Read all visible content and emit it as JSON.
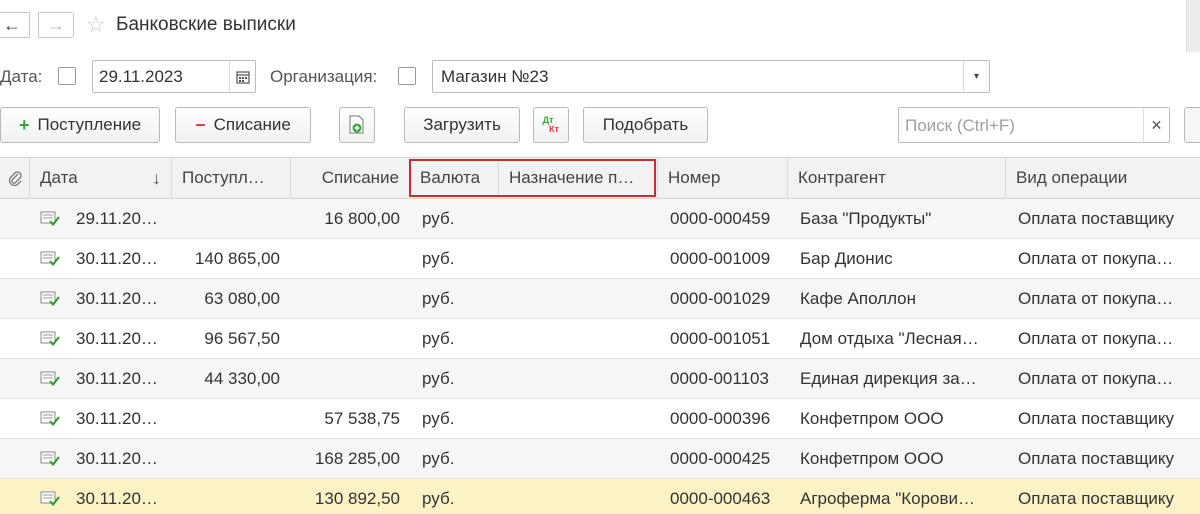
{
  "window": {
    "title": "Банковские выписки"
  },
  "filters": {
    "date_label": "Дата:",
    "date_value": "29.11.2023",
    "org_label": "Организация:",
    "org_value": "Магазин №23"
  },
  "toolbar": {
    "incoming_label": "Поступление",
    "outgoing_label": "Списание",
    "load_label": "Загрузить",
    "dtkt_top": "Дт",
    "dtkt_bottom": "Кт",
    "select_label": "Подобрать",
    "search_placeholder": "Поиск (Ctrl+F)"
  },
  "table": {
    "columns": {
      "date": "Дата",
      "incoming": "Поступл…",
      "outgoing": "Списание",
      "currency": "Валюта",
      "purpose": "Назначение п…",
      "number": "Номер",
      "counterparty": "Контрагент",
      "operation": "Вид операции"
    },
    "rows": [
      {
        "date": "29.11.20…",
        "incoming": "",
        "outgoing": "16 800,00",
        "currency": "руб.",
        "purpose": "",
        "number": "0000-000459",
        "counterparty": "База \"Продукты\"",
        "operation": "Оплата поставщику"
      },
      {
        "date": "30.11.20…",
        "incoming": "140 865,00",
        "outgoing": "",
        "currency": "руб.",
        "purpose": "",
        "number": "0000-001009",
        "counterparty": "Бар Дионис",
        "operation": "Оплата от покупа…"
      },
      {
        "date": "30.11.20…",
        "incoming": "63 080,00",
        "outgoing": "",
        "currency": "руб.",
        "purpose": "",
        "number": "0000-001029",
        "counterparty": "Кафе Аполлон",
        "operation": "Оплата от покупа…"
      },
      {
        "date": "30.11.20…",
        "incoming": "96 567,50",
        "outgoing": "",
        "currency": "руб.",
        "purpose": "",
        "number": "0000-001051",
        "counterparty": "Дом отдыха \"Лесная…",
        "operation": "Оплата от покупа…"
      },
      {
        "date": "30.11.20…",
        "incoming": "44 330,00",
        "outgoing": "",
        "currency": "руб.",
        "purpose": "",
        "number": "0000-001103",
        "counterparty": "Единая дирекция за…",
        "operation": "Оплата от покупа…"
      },
      {
        "date": "30.11.20…",
        "incoming": "",
        "outgoing": "57 538,75",
        "currency": "руб.",
        "purpose": "",
        "number": "0000-000396",
        "counterparty": "Конфетпром ООО",
        "operation": "Оплата поставщику"
      },
      {
        "date": "30.11.20…",
        "incoming": "",
        "outgoing": "168 285,00",
        "currency": "руб.",
        "purpose": "",
        "number": "0000-000425",
        "counterparty": "Конфетпром ООО",
        "operation": "Оплата поставщику"
      },
      {
        "date": "30.11.20…",
        "incoming": "",
        "outgoing": "130 892,50",
        "currency": "руб.",
        "purpose": "",
        "number": "0000-000463",
        "counterparty": "Агроферма \"Корови…",
        "operation": "Оплата поставщику"
      }
    ]
  },
  "colors": {
    "highlight_border": "#c62f2f",
    "selected_row": "#fbf3c6",
    "plus_green": "#3aa13a",
    "minus_red": "#d64040"
  },
  "icons": [
    "arrow-left-icon",
    "arrow-right-icon",
    "star-icon",
    "calendar-icon",
    "dropdown-icon",
    "plus-icon",
    "minus-icon",
    "add-document-icon",
    "dtkt-icon",
    "clear-icon",
    "attachment-icon",
    "sort-down-icon",
    "document-posted-icon"
  ]
}
